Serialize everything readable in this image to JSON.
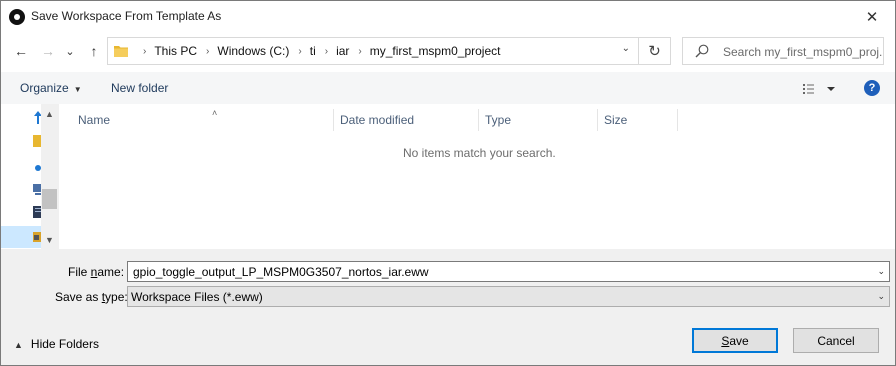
{
  "window": {
    "title": "Save Workspace From Template As",
    "close_glyph": "✕"
  },
  "nav": {
    "back_glyph": "←",
    "forward_glyph": "→",
    "recent_glyph": "⌄",
    "up_glyph": "↑",
    "breadcrumbs": [
      {
        "label": "This PC"
      },
      {
        "label": "Windows (C:)"
      },
      {
        "label": "ti"
      },
      {
        "label": "iar"
      },
      {
        "label": "my_first_mspm0_project"
      }
    ],
    "crumb_separator": "›",
    "address_dropdown_glyph": "⌄",
    "refresh_glyph": "↻",
    "search_placeholder": "Search my_first_mspm0_proj..."
  },
  "toolbar": {
    "organize_label": "Organize",
    "new_folder_label": "New folder",
    "help_label": "?"
  },
  "columns": [
    {
      "label": "Name"
    },
    {
      "label": "Date modified"
    },
    {
      "label": "Type"
    },
    {
      "label": "Size"
    }
  ],
  "empty_message": "No items match your search.",
  "form": {
    "filename_label": "File name:",
    "filename_value": "gpio_toggle_output_LP_MSPM0G3507_nortos_iar.eww",
    "savetype_label": "Save as type:",
    "savetype_value": "Workspace Files (*.eww)"
  },
  "footer": {
    "hide_folders_label": "Hide Folders",
    "save_label": "Save",
    "cancel_label": "Cancel"
  },
  "colors": {
    "accent": "#0078d7",
    "folder": "#e8b730",
    "help": "#1e5fba",
    "selection": "#cce8ff"
  }
}
